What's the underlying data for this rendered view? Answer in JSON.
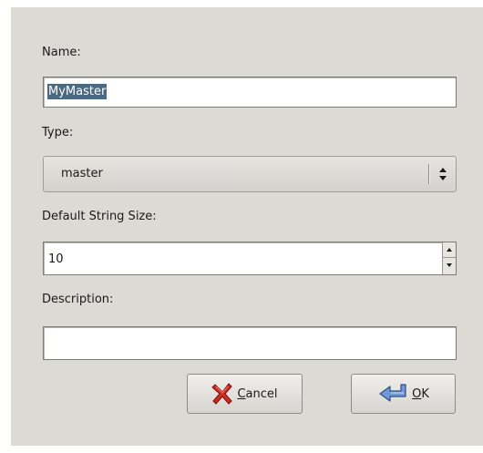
{
  "fields": {
    "name_label": "Name:",
    "name_value": "MyMaster",
    "type_label": "Type:",
    "type_value": "master",
    "size_label": "Default String Size:",
    "size_value": "10",
    "description_label": "Description:",
    "description_value": ""
  },
  "buttons": {
    "cancel_mnemonic": "C",
    "cancel_rest": "ancel",
    "ok_mnemonic": "O",
    "ok_rest": "K"
  },
  "icons": {
    "cancel": "red-x-icon",
    "ok": "enter-arrow-icon"
  },
  "colors": {
    "dialog_bg": "#dcdad5",
    "selection": "#4b6983",
    "cancel_icon": "#d12b1e",
    "ok_icon": "#3f6fb5"
  }
}
